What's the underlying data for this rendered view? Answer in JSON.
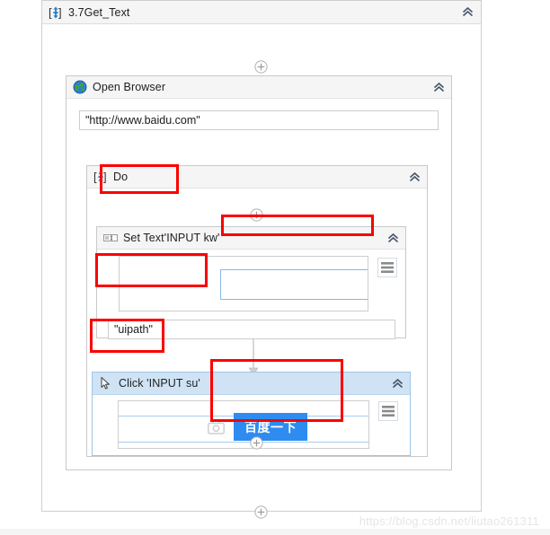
{
  "window": {
    "watermark": "https://blog.csdn.net/liutao261311"
  },
  "root_sequence": {
    "title": "3.7Get_Text",
    "icon": "sequence-icon",
    "collapse_icon": "chevron-double-up-icon",
    "add_top_label": "+",
    "add_bottom_label": "+"
  },
  "open_browser": {
    "title": "Open Browser",
    "icon": "globe-icon",
    "collapse_icon": "chevron-double-up-icon",
    "url_value": "\"http://www.baidu.com\""
  },
  "do_sequence": {
    "title": "Do",
    "icon": "sequence-icon",
    "collapse_icon": "chevron-double-up-icon",
    "add_top_label": "+",
    "add_bottom_label": "+"
  },
  "set_text": {
    "title": "Set Text",
    "target": "'INPUT  kw'",
    "icon": "text-field-icon",
    "collapse_icon": "chevron-double-up-icon",
    "menu_icon": "hamburger-menu-icon",
    "value": "\"uipath\"",
    "selector_preview_name": "input-field-preview"
  },
  "click": {
    "title": "Click",
    "target": "'INPUT  su'",
    "icon": "cursor-pointer-icon",
    "collapse_icon": "chevron-double-up-icon",
    "menu_icon": "hamburger-menu-icon",
    "camera_icon": "camera-icon",
    "button_label": "百度一下",
    "button_color": "#2e8cf0",
    "selected": "true"
  },
  "annotations": {
    "color": "#fa0000",
    "boxes": [
      {
        "name": "set-text-label-highlight"
      },
      {
        "name": "text-caret-highlight"
      },
      {
        "name": "uipath-value-highlight"
      },
      {
        "name": "click-label-highlight"
      },
      {
        "name": "baidu-button-highlight"
      }
    ]
  }
}
